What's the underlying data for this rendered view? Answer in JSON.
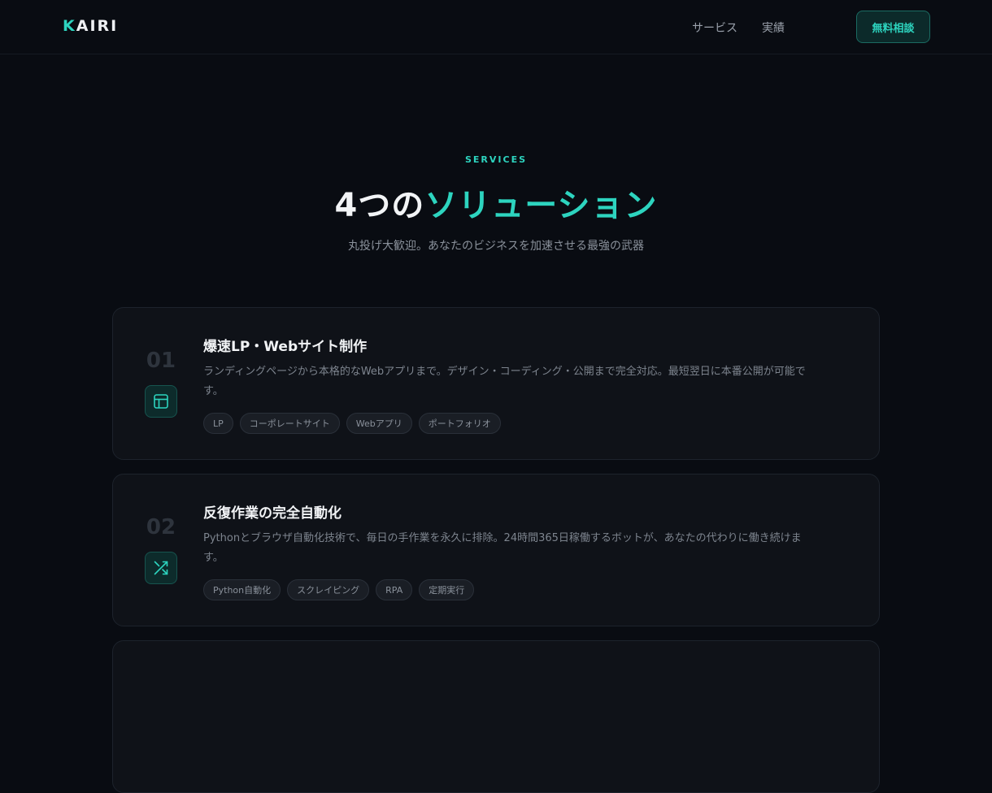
{
  "header": {
    "logo_first": "K",
    "logo_rest": "AIRI",
    "nav": [
      "サービス",
      "実績"
    ],
    "cta_label": "無料相談"
  },
  "hero": {
    "eyebrow": "SERVICES",
    "title_plain": "4つの",
    "title_accent": "ソリューション",
    "subtitle": "丸投げ大歓迎。あなたのビジネスを加速させる最強の武器"
  },
  "services": [
    {
      "number": "01",
      "icon": "layout-icon",
      "title": "爆速LP・Webサイト制作",
      "description": "ランディングページから本格的なWebアプリまで。デザイン・コーディング・公開まで完全対応。最短翌日に本番公開が可能です。",
      "tags": [
        "LP",
        "コーポレートサイト",
        "Webアプリ",
        "ポートフォリオ"
      ]
    },
    {
      "number": "02",
      "icon": "shuffle-icon",
      "title": "反復作業の完全自動化",
      "description": "Pythonとブラウザ自動化技術で、毎日の手作業を永久に排除。24時間365日稼働するボットが、あなたの代わりに働き続けます。",
      "tags": [
        "Python自動化",
        "スクレイピング",
        "RPA",
        "定期実行"
      ]
    }
  ],
  "colors": {
    "background": "#090c12",
    "accent": "#2dd4bf",
    "card": "#0f1218",
    "border": "#1d232c"
  }
}
